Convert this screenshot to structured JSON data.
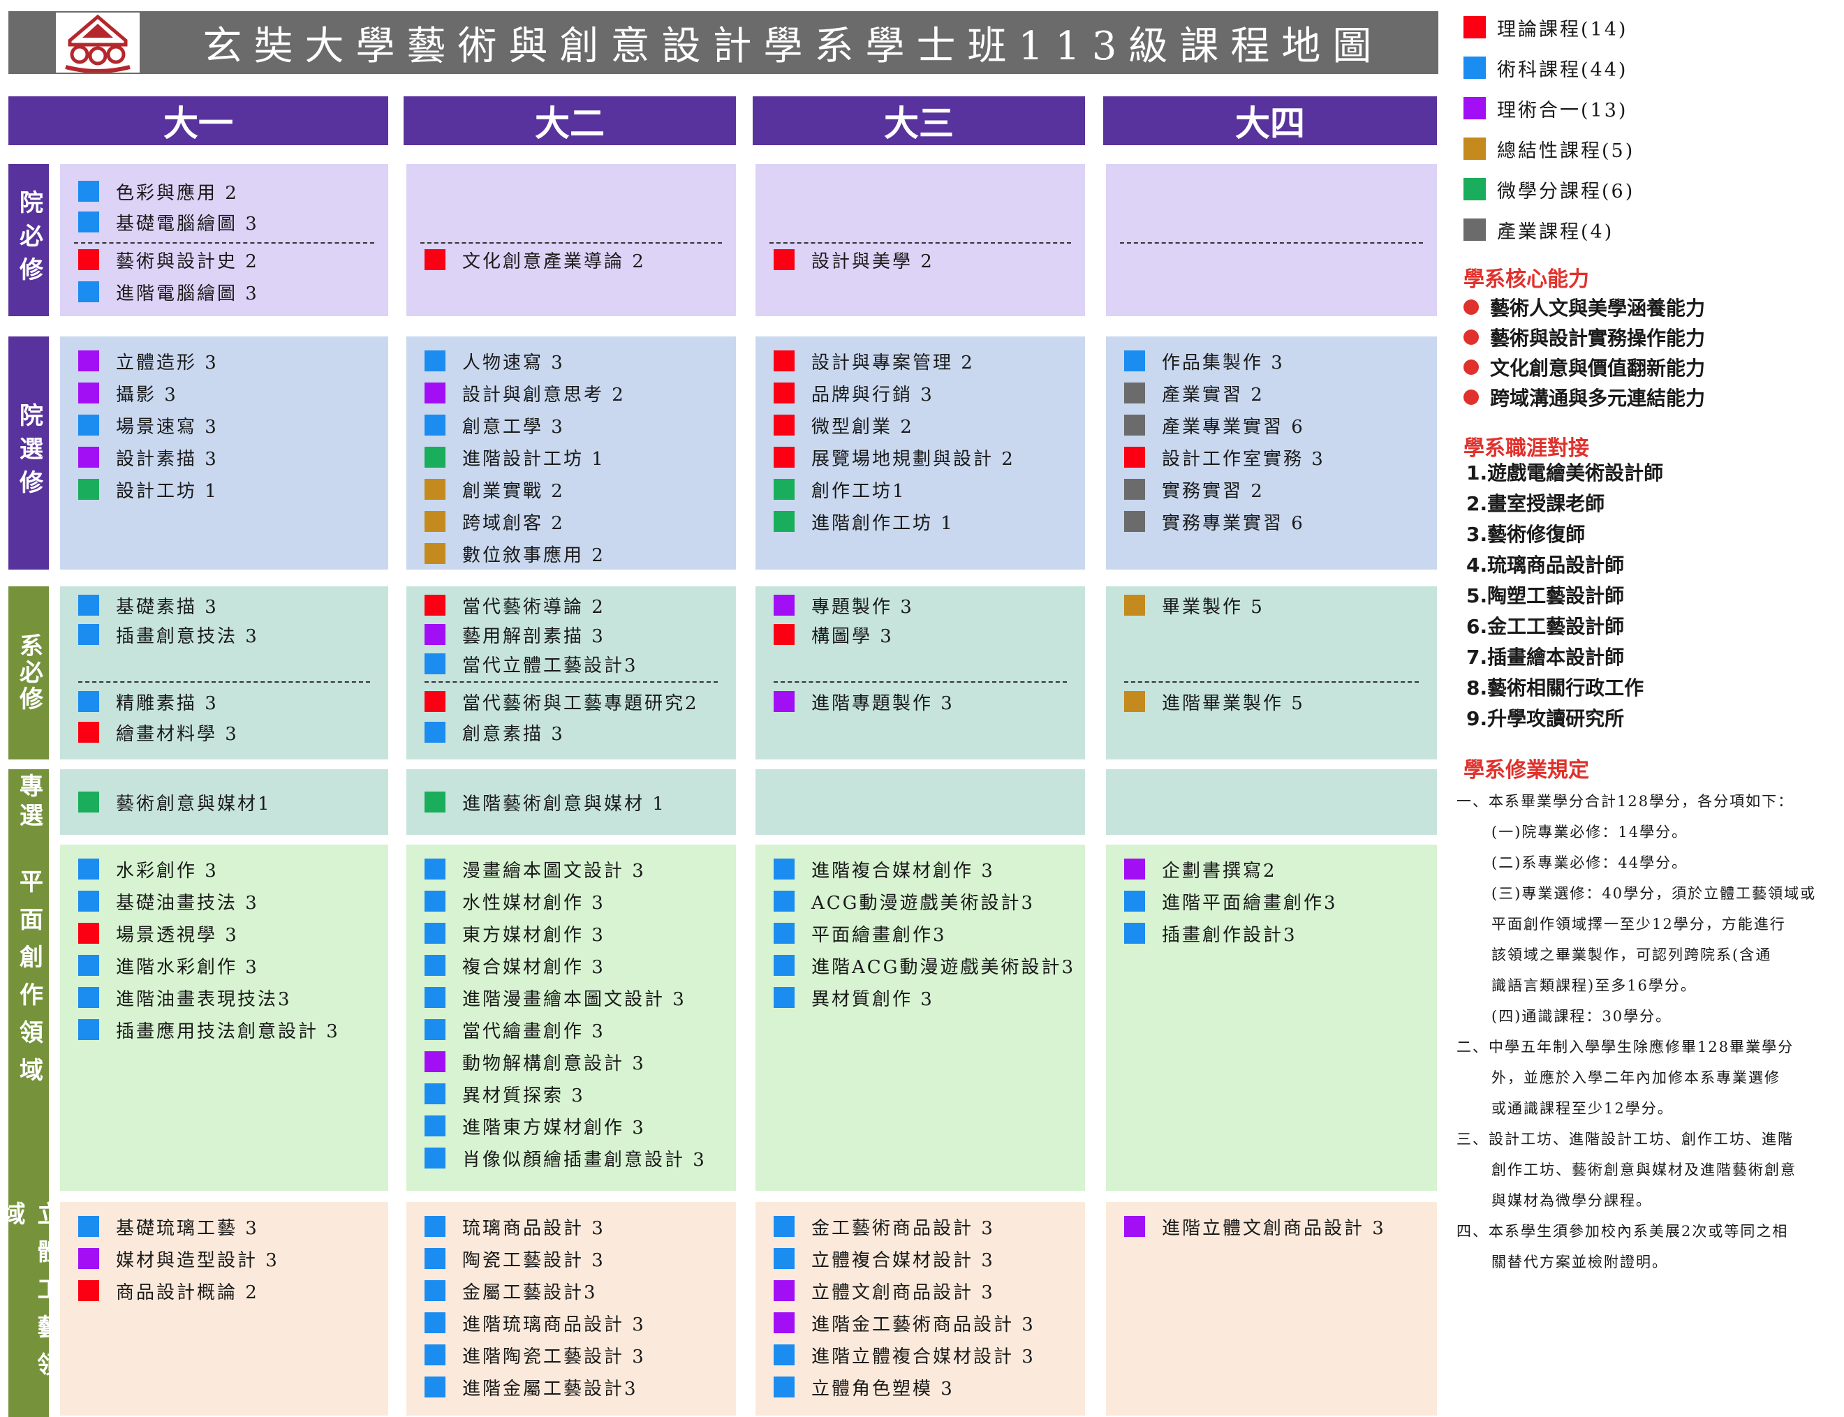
{
  "title": "玄奘大學藝術與創意設計學系學士班113級課程地圖",
  "colors": {
    "theory": "#fa0012",
    "technique": "#1b8cf0",
    "integrated": "#a20ff5",
    "capstone": "#c48a1e",
    "microcredit": "#1aad5b",
    "industry": "#6b6b6b"
  },
  "years": [
    "大一",
    "大二",
    "大三",
    "大四"
  ],
  "rows": {
    "college_required": "院必修",
    "college_elective": "院選修",
    "dept_required": "系必修",
    "specialized_elective": "專選",
    "flat_creation": "平面創作領域",
    "three_d_craft": "立體工藝領域"
  },
  "courses": {
    "college_required": [
      {
        "top": [
          {
            "c": "technique",
            "t": "色彩與應用 2"
          },
          {
            "c": "technique",
            "t": "基礎電腦繪圖 3"
          }
        ],
        "bottom": [
          {
            "c": "theory",
            "t": "藝術與設計史 2"
          },
          {
            "c": "technique",
            "t": "進階電腦繪圖 3"
          }
        ]
      },
      {
        "top": [],
        "bottom": [
          {
            "c": "theory",
            "t": "文化創意產業導論 2"
          }
        ]
      },
      {
        "top": [],
        "bottom": [
          {
            "c": "theory",
            "t": "設計與美學 2"
          }
        ]
      },
      {
        "top": [],
        "bottom": []
      }
    ],
    "college_elective": [
      [
        {
          "c": "integrated",
          "t": "立體造形 3"
        },
        {
          "c": "integrated",
          "t": "攝影 3"
        },
        {
          "c": "technique",
          "t": "場景速寫 3"
        },
        {
          "c": "integrated",
          "t": "設計素描 3"
        },
        {
          "c": "microcredit",
          "t": "設計工坊 1"
        }
      ],
      [
        {
          "c": "technique",
          "t": "人物速寫 3"
        },
        {
          "c": "integrated",
          "t": "設計與創意思考 2"
        },
        {
          "c": "technique",
          "t": "創意工學 3"
        },
        {
          "c": "microcredit",
          "t": "進階設計工坊 1"
        },
        {
          "c": "capstone",
          "t": "創業實戰 2"
        },
        {
          "c": "capstone",
          "t": "跨域創客 2"
        },
        {
          "c": "capstone",
          "t": "數位敘事應用 2"
        }
      ],
      [
        {
          "c": "theory",
          "t": "設計與專案管理 2"
        },
        {
          "c": "theory",
          "t": "品牌與行銷 3"
        },
        {
          "c": "theory",
          "t": "微型創業 2"
        },
        {
          "c": "theory",
          "t": "展覽場地規劃與設計 2"
        },
        {
          "c": "microcredit",
          "t": "創作工坊1"
        },
        {
          "c": "microcredit",
          "t": "進階創作工坊 1"
        }
      ],
      [
        {
          "c": "technique",
          "t": "作品集製作 3"
        },
        {
          "c": "industry",
          "t": "產業實習 2"
        },
        {
          "c": "industry",
          "t": "產業專業實習 6"
        },
        {
          "c": "theory",
          "t": "設計工作室實務 3"
        },
        {
          "c": "industry",
          "t": "實務實習 2"
        },
        {
          "c": "industry",
          "t": "實務專業實習 6"
        }
      ]
    ],
    "dept_required": [
      {
        "top": [
          {
            "c": "technique",
            "t": "基礎素描 3"
          },
          {
            "c": "technique",
            "t": "插畫創意技法 3"
          }
        ],
        "bottom": [
          {
            "c": "technique",
            "t": "精雕素描 3"
          },
          {
            "c": "theory",
            "t": "繪畫材料學 3"
          }
        ]
      },
      {
        "top": [
          {
            "c": "theory",
            "t": "當代藝術導論 2"
          },
          {
            "c": "integrated",
            "t": "藝用解剖素描 3"
          },
          {
            "c": "technique",
            "t": "當代立體工藝設計3"
          }
        ],
        "bottom": [
          {
            "c": "theory",
            "t": "當代藝術與工藝專題研究2"
          },
          {
            "c": "technique",
            "t": "創意素描 3"
          }
        ]
      },
      {
        "top": [
          {
            "c": "integrated",
            "t": "專題製作 3"
          },
          {
            "c": "theory",
            "t": "構圖學 3"
          }
        ],
        "bottom": [
          {
            "c": "integrated",
            "t": "進階專題製作 3"
          }
        ]
      },
      {
        "top": [
          {
            "c": "capstone",
            "t": "畢業製作 5"
          }
        ],
        "bottom": [
          {
            "c": "capstone",
            "t": "進階畢業製作 5"
          }
        ]
      }
    ],
    "specialized_elective": [
      [
        {
          "c": "microcredit",
          "t": "藝術創意與媒材1"
        }
      ],
      [
        {
          "c": "microcredit",
          "t": "進階藝術創意與媒材 1"
        }
      ],
      [],
      []
    ],
    "flat_creation": [
      [
        {
          "c": "technique",
          "t": "水彩創作 3"
        },
        {
          "c": "technique",
          "t": "基礎油畫技法 3"
        },
        {
          "c": "theory",
          "t": "場景透視學 3"
        },
        {
          "c": "technique",
          "t": "進階水彩創作 3"
        },
        {
          "c": "technique",
          "t": "進階油畫表現技法3"
        },
        {
          "c": "technique",
          "t": "插畫應用技法創意設計 3"
        }
      ],
      [
        {
          "c": "technique",
          "t": "漫畫繪本圖文設計 3"
        },
        {
          "c": "technique",
          "t": "水性媒材創作 3"
        },
        {
          "c": "technique",
          "t": "東方媒材創作 3"
        },
        {
          "c": "technique",
          "t": "複合媒材創作 3"
        },
        {
          "c": "technique",
          "t": "進階漫畫繪本圖文設計 3"
        },
        {
          "c": "technique",
          "t": "當代繪畫創作 3"
        },
        {
          "c": "integrated",
          "t": "動物解構創意設計 3"
        },
        {
          "c": "technique",
          "t": "異材質探索 3"
        },
        {
          "c": "technique",
          "t": "進階東方媒材創作 3"
        },
        {
          "c": "technique",
          "t": "肖像似顏繪插畫創意設計 3"
        }
      ],
      [
        {
          "c": "technique",
          "t": "進階複合媒材創作 3"
        },
        {
          "c": "technique",
          "t": "ACG動漫遊戲美術設計3"
        },
        {
          "c": "technique",
          "t": "平面繪畫創作3"
        },
        {
          "c": "technique",
          "t": "進階ACG動漫遊戲美術設計3"
        },
        {
          "c": "technique",
          "t": "異材質創作 3"
        }
      ],
      [
        {
          "c": "integrated",
          "t": "企劃書撰寫2"
        },
        {
          "c": "technique",
          "t": "進階平面繪畫創作3"
        },
        {
          "c": "technique",
          "t": "插畫創作設計3"
        }
      ]
    ],
    "three_d_craft": [
      [
        {
          "c": "technique",
          "t": "基礎琉璃工藝 3"
        },
        {
          "c": "integrated",
          "t": "媒材與造型設計 3"
        },
        {
          "c": "theory",
          "t": "商品設計概論 2"
        }
      ],
      [
        {
          "c": "technique",
          "t": "琉璃商品設計 3"
        },
        {
          "c": "technique",
          "t": "陶瓷工藝設計 3"
        },
        {
          "c": "technique",
          "t": "金屬工藝設計3"
        },
        {
          "c": "technique",
          "t": "進階琉璃商品設計 3"
        },
        {
          "c": "technique",
          "t": "進階陶瓷工藝設計 3"
        },
        {
          "c": "technique",
          "t": "進階金屬工藝設計3"
        }
      ],
      [
        {
          "c": "technique",
          "t": "金工藝術商品設計 3"
        },
        {
          "c": "technique",
          "t": "立體複合媒材設計 3"
        },
        {
          "c": "integrated",
          "t": "立體文創商品設計 3"
        },
        {
          "c": "integrated",
          "t": "進階金工藝術商品設計 3"
        },
        {
          "c": "technique",
          "t": "進階立體複合媒材設計 3"
        },
        {
          "c": "technique",
          "t": "立體角色塑模 3"
        }
      ],
      [
        {
          "c": "integrated",
          "t": "進階立體文創商品設計 3"
        }
      ]
    ]
  },
  "legend": [
    {
      "c": "theory",
      "t": "理論課程(14)"
    },
    {
      "c": "technique",
      "t": "術科課程(44)"
    },
    {
      "c": "integrated",
      "t": "理術合一(13)"
    },
    {
      "c": "capstone",
      "t": "總結性課程(5)"
    },
    {
      "c": "microcredit",
      "t": "微學分課程(6)"
    },
    {
      "c": "industry",
      "t": "產業課程(4)"
    }
  ],
  "core_title": "學系核心能力",
  "core_abilities": [
    "藝術人文與美學涵養能力",
    "藝術與設計實務操作能力",
    "文化創意與價值翻新能力",
    "跨域溝通與多元連結能力"
  ],
  "career_title": "學系職涯對接",
  "careers": [
    "1.遊戲電繪美術設計師",
    "2.畫室授課老師",
    "3.藝術修復師",
    "4.琉璃商品設計師",
    "5.陶塑工藝設計師",
    "6.金工工藝設計師",
    "7.插畫繪本設計師",
    "8.藝術相關行政工作",
    "9.升學攻讀研究所"
  ],
  "rules_title": "學系修業規定",
  "rules": [
    "一、本系畢業學分合計128學分，各分項如下：",
    "(一)院專業必修：14學分。",
    "(二)系專業必修：44學分。",
    "(三)專業選修：40學分，須於立體工藝領域或",
    "平面創作領域擇一至少12學分，方能進行",
    "該領域之畢業製作，可認列跨院系(含通",
    "識語言類課程)至多16學分。",
    "(四)通識課程：30學分。",
    "二、中學五年制入學學生除應修畢128畢業學分",
    "外，並應於入學二年內加修本系專業選修",
    "或通識課程至少12學分。",
    "三、設計工坊、進階設計工坊、創作工坊、進階",
    "創作工坊、藝術創意與媒材及進階藝術創意",
    "與媒材為微學分課程。",
    "四、本系學生須參加校內系美展2次或等同之相",
    "關替代方案並檢附證明。"
  ]
}
